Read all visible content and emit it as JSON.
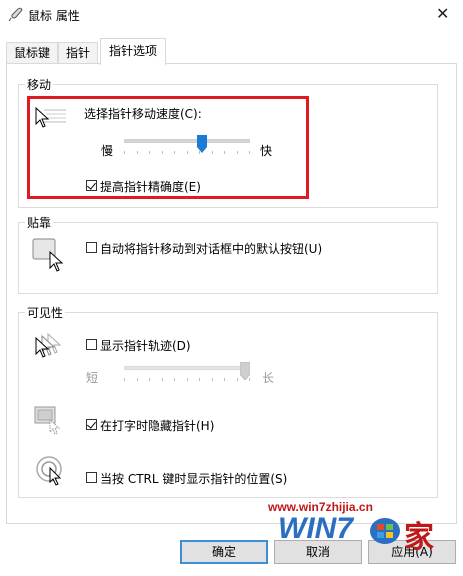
{
  "window": {
    "title": "鼠标 属性",
    "close_glyph": "✕"
  },
  "tabs": [
    {
      "label": "鼠标键"
    },
    {
      "label": "指针"
    },
    {
      "label": "指针选项"
    }
  ],
  "motion": {
    "group_label": "移动",
    "speed_label": "选择指针移动速度(C):",
    "slow_label": "慢",
    "fast_label": "快",
    "speed_value_fraction": 0.63,
    "precision_label": "提高指针精确度(E)",
    "precision_checked": true,
    "icon": "pointer-speed-icon"
  },
  "snap": {
    "group_label": "贴靠",
    "snap_label": "自动将指针移动到对话框中的默认按钮(U)",
    "snap_checked": false,
    "icon": "snap-to-button-icon"
  },
  "visibility": {
    "group_label": "可见性",
    "trails_label": "显示指针轨迹(D)",
    "trails_checked": false,
    "short_label": "短",
    "long_label": "长",
    "trails_value_fraction": 1.0,
    "hide_label": "在打字时隐藏指针(H)",
    "hide_checked": true,
    "ctrl_label": "当按 CTRL 键时显示指针的位置(S)",
    "ctrl_checked": false
  },
  "buttons": {
    "ok": "确定",
    "cancel": "取消",
    "apply": "应用(A)"
  },
  "watermark": {
    "url": "www.win7zhijia.cn",
    "brand_main": "WIN7",
    "brand_suffix": "家"
  },
  "colors": {
    "highlight_box": "#e01a22",
    "slider_thumb": "#1c7cd5",
    "focus_border": "#3a8fd6"
  }
}
